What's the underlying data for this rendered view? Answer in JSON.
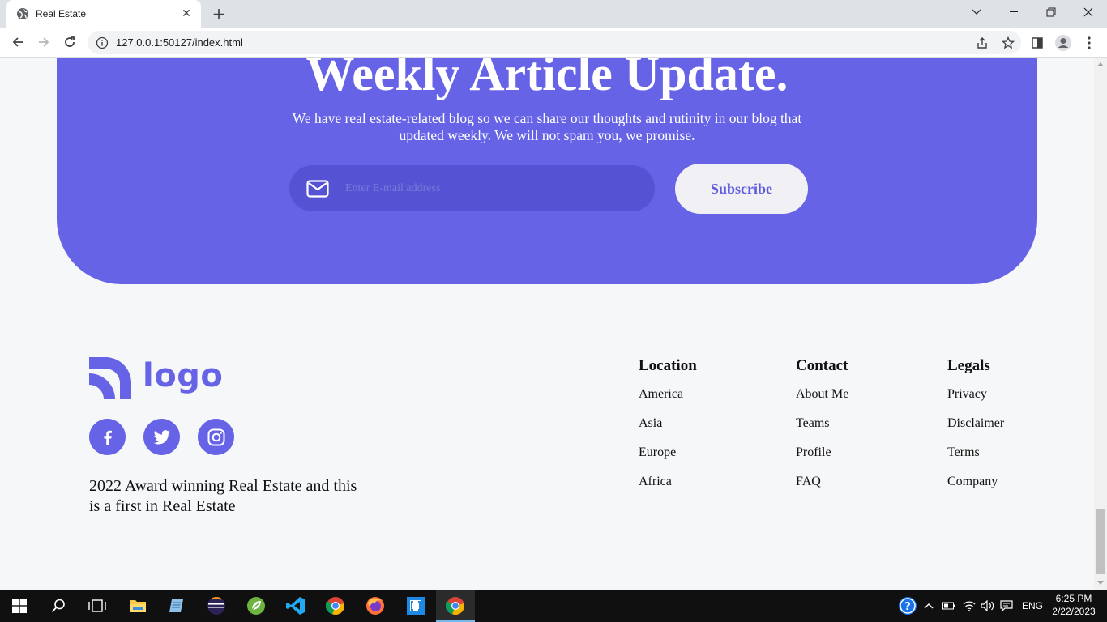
{
  "browser": {
    "tab_title": "Real Estate",
    "url": "127.0.0.1:50127/index.html"
  },
  "newsletter": {
    "heading": "Weekly Article Update.",
    "description": "We have real estate-related blog so we can share our thoughts and rutinity in our blog that updated weekly. We will not spam you, we promise.",
    "email_placeholder": "Enter E-mail address",
    "subscribe_label": "Subscribe",
    "accent_color": "#6663e6"
  },
  "footer": {
    "logo_text": "logo",
    "social_icons": [
      "facebook-icon",
      "twitter-icon",
      "instagram-icon"
    ],
    "tagline": "2022 Award winning Real Estate and this is a first in Real Estate",
    "columns": [
      {
        "title": "Location",
        "items": [
          "America",
          "Asia",
          "Europe",
          "Africa"
        ]
      },
      {
        "title": "Contact",
        "items": [
          "About Me",
          "Teams",
          "Profile",
          "FAQ"
        ]
      },
      {
        "title": "Legals",
        "items": [
          "Privacy",
          "Disclaimer",
          "Terms",
          "Company"
        ]
      }
    ]
  },
  "taskbar": {
    "language": "ENG",
    "time": "6:25 PM",
    "date": "2/22/2023"
  }
}
